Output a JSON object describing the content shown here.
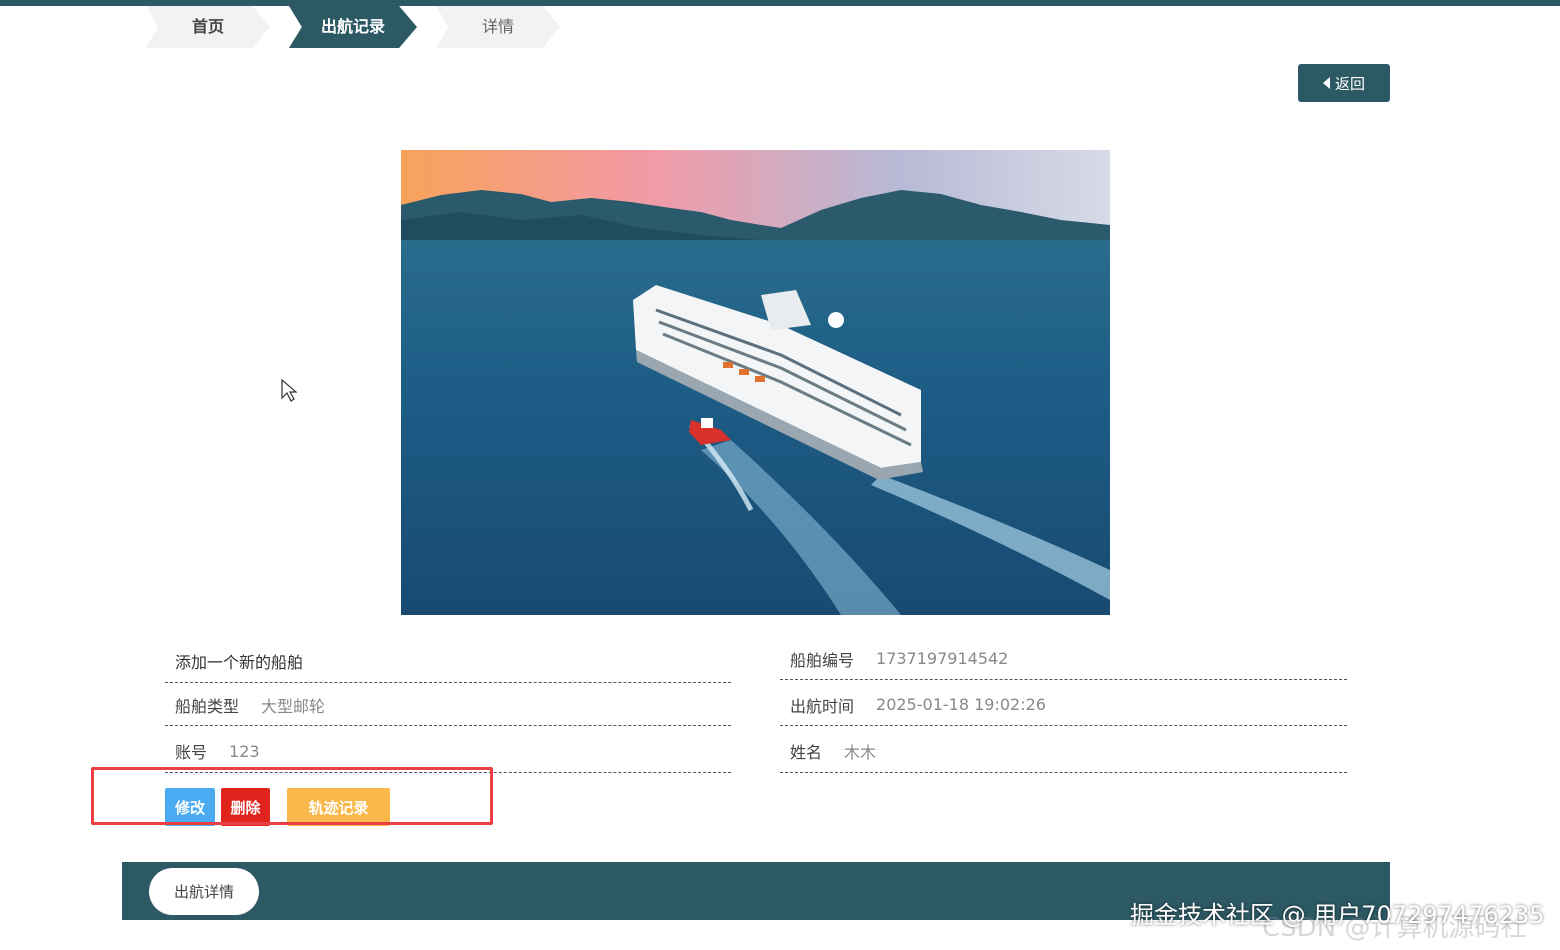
{
  "breadcrumb": {
    "home": "首页",
    "records": "出航记录",
    "detail": "详情"
  },
  "header": {
    "back_label": "返回"
  },
  "hero": {
    "alt": "cruise-ship-photo"
  },
  "info": {
    "title": "添加一个新的船舶",
    "ship_type_label": "船舶类型",
    "ship_type_value": "大型邮轮",
    "account_label": "账号",
    "account_value": "123",
    "ship_no_label": "船舶编号",
    "ship_no_value": "1737197914542",
    "depart_time_label": "出航时间",
    "depart_time_value": "2025-01-18 19:02:26",
    "name_label": "姓名",
    "name_value": "木木"
  },
  "actions": {
    "edit": "修改",
    "delete": "删除",
    "track": "轨迹记录"
  },
  "footer": {
    "tab": "出航详情"
  },
  "watermarks": {
    "juejin": "掘金技术社区 @ 用户707297476235",
    "csdn": "CSDN @计算机源码社"
  },
  "colors": {
    "primary": "#2d5964",
    "edit": "#4aaaf2",
    "delete": "#e0231c",
    "track": "#fbb84a",
    "highlight": "#ea3f44"
  }
}
